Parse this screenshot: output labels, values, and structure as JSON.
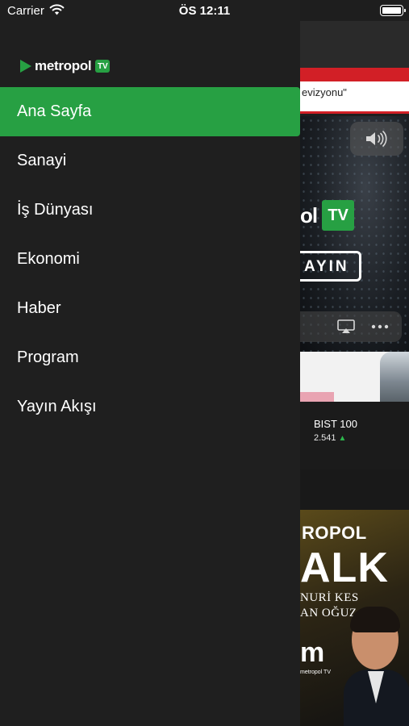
{
  "status_bar": {
    "carrier": "Carrier",
    "time": "ÖS 12:11"
  },
  "brand": {
    "name": "metropol",
    "tv_badge": "TV",
    "accent_color": "#27a043"
  },
  "drawer": {
    "active_index": 0,
    "items": [
      {
        "label": "Ana Sayfa"
      },
      {
        "label": "Sanayi"
      },
      {
        "label": "İş Dünyası"
      },
      {
        "label": "Ekonomi"
      },
      {
        "label": "Haber"
      },
      {
        "label": "Program"
      },
      {
        "label": "Yayın Akışı"
      }
    ]
  },
  "background": {
    "ticker_text": "evizyonu\"",
    "video_brand": "ol",
    "video_badge": "TV",
    "video_live_label": "AYIN",
    "stock": {
      "name": "BIST 100",
      "value": "2.541",
      "trend_icon": "arrow-up-icon"
    },
    "poster": {
      "line1": "ROPOL",
      "line2": "ALK",
      "line3": "NURİ KES",
      "line4": "AN OĞUZ",
      "mark": "m",
      "sub": "metropol TV"
    }
  }
}
